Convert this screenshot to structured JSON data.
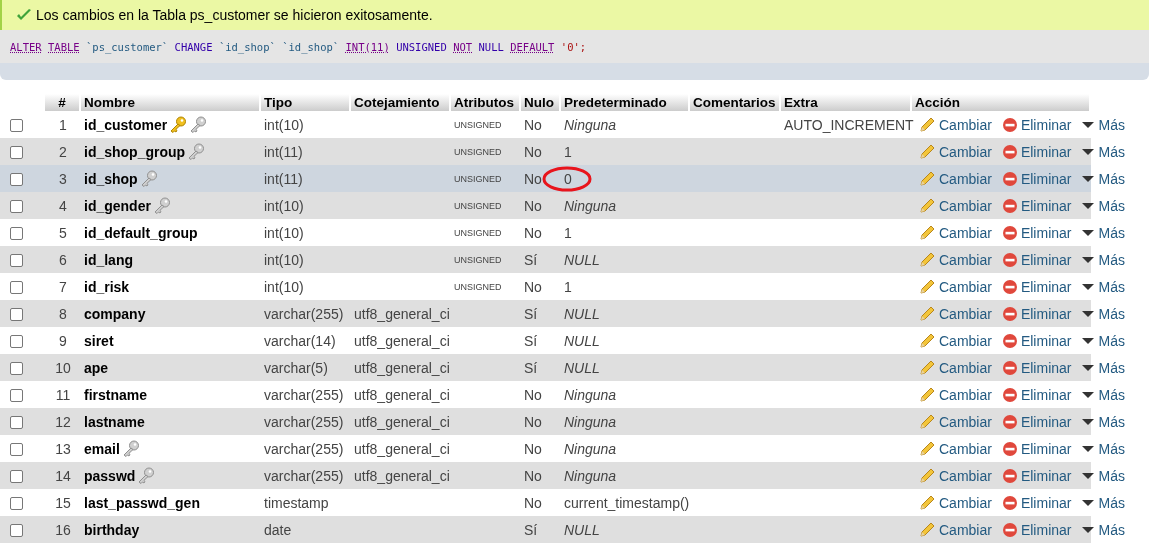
{
  "message": {
    "kind": "success",
    "text": "Los cambios en la Tabla ps_customer se hicieron exitosamente."
  },
  "sql": [
    {
      "kind": "keyword",
      "text": "ALTER"
    },
    {
      "kind": "keyword",
      "text": "TABLE"
    },
    {
      "kind": "ident",
      "text": "`ps_customer`"
    },
    {
      "kind": "plain",
      "text": "CHANGE"
    },
    {
      "kind": "ident",
      "text": "`id_shop`"
    },
    {
      "kind": "ident",
      "text": "`id_shop`"
    },
    {
      "kind": "func",
      "text": "INT(11)"
    },
    {
      "kind": "plain",
      "text": "UNSIGNED"
    },
    {
      "kind": "keyword",
      "text": "NOT"
    },
    {
      "kind": "plain",
      "text": "NULL"
    },
    {
      "kind": "keyword",
      "text": "DEFAULT"
    },
    {
      "kind": "string",
      "text": "'0';"
    }
  ],
  "table": {
    "columns": [
      "#",
      "Nombre",
      "Tipo",
      "Cotejamiento",
      "Atributos",
      "Nulo",
      "Predeterminado",
      "Comentarios",
      "Extra",
      "Acción"
    ],
    "rows": [
      {
        "num": "1",
        "name": "id_customer",
        "primary_key": true,
        "indexed": true,
        "type": "int(10)",
        "collation": "",
        "attributes": "UNSIGNED",
        "null": "No",
        "default": "Ninguna",
        "default_italic": true,
        "extra": "AUTO_INCREMENT",
        "checked": false,
        "highlighted": false,
        "circled": false,
        "actions": [
          "Cambiar",
          "Eliminar",
          "Más"
        ]
      },
      {
        "num": "2",
        "name": "id_shop_group",
        "primary_key": false,
        "indexed": true,
        "type": "int(11)",
        "collation": "",
        "attributes": "UNSIGNED",
        "null": "No",
        "default": "1",
        "default_italic": false,
        "extra": "",
        "checked": false,
        "highlighted": false,
        "circled": false,
        "actions": [
          "Cambiar",
          "Eliminar",
          "Más"
        ]
      },
      {
        "num": "3",
        "name": "id_shop",
        "primary_key": false,
        "indexed": true,
        "type": "int(11)",
        "collation": "",
        "attributes": "UNSIGNED",
        "null": "No",
        "default": "0",
        "default_italic": false,
        "extra": "",
        "checked": false,
        "highlighted": true,
        "circled": true,
        "actions": [
          "Cambiar",
          "Eliminar",
          "Más"
        ]
      },
      {
        "num": "4",
        "name": "id_gender",
        "primary_key": false,
        "indexed": true,
        "type": "int(10)",
        "collation": "",
        "attributes": "UNSIGNED",
        "null": "No",
        "default": "Ninguna",
        "default_italic": true,
        "extra": "",
        "checked": false,
        "highlighted": false,
        "circled": false,
        "actions": [
          "Cambiar",
          "Eliminar",
          "Más"
        ]
      },
      {
        "num": "5",
        "name": "id_default_group",
        "primary_key": false,
        "indexed": false,
        "type": "int(10)",
        "collation": "",
        "attributes": "UNSIGNED",
        "null": "No",
        "default": "1",
        "default_italic": false,
        "extra": "",
        "checked": false,
        "highlighted": false,
        "circled": false,
        "actions": [
          "Cambiar",
          "Eliminar",
          "Más"
        ]
      },
      {
        "num": "6",
        "name": "id_lang",
        "primary_key": false,
        "indexed": false,
        "type": "int(10)",
        "collation": "",
        "attributes": "UNSIGNED",
        "null": "Sí",
        "default": "NULL",
        "default_italic": true,
        "extra": "",
        "checked": false,
        "highlighted": false,
        "circled": false,
        "actions": [
          "Cambiar",
          "Eliminar",
          "Más"
        ]
      },
      {
        "num": "7",
        "name": "id_risk",
        "primary_key": false,
        "indexed": false,
        "type": "int(10)",
        "collation": "",
        "attributes": "UNSIGNED",
        "null": "No",
        "default": "1",
        "default_italic": false,
        "extra": "",
        "checked": false,
        "highlighted": false,
        "circled": false,
        "actions": [
          "Cambiar",
          "Eliminar",
          "Más"
        ]
      },
      {
        "num": "8",
        "name": "company",
        "primary_key": false,
        "indexed": false,
        "type": "varchar(255)",
        "collation": "utf8_general_ci",
        "attributes": "",
        "null": "Sí",
        "default": "NULL",
        "default_italic": true,
        "extra": "",
        "checked": false,
        "highlighted": false,
        "circled": false,
        "actions": [
          "Cambiar",
          "Eliminar",
          "Más"
        ]
      },
      {
        "num": "9",
        "name": "siret",
        "primary_key": false,
        "indexed": false,
        "type": "varchar(14)",
        "collation": "utf8_general_ci",
        "attributes": "",
        "null": "Sí",
        "default": "NULL",
        "default_italic": true,
        "extra": "",
        "checked": false,
        "highlighted": false,
        "circled": false,
        "actions": [
          "Cambiar",
          "Eliminar",
          "Más"
        ]
      },
      {
        "num": "10",
        "name": "ape",
        "primary_key": false,
        "indexed": false,
        "type": "varchar(5)",
        "collation": "utf8_general_ci",
        "attributes": "",
        "null": "Sí",
        "default": "NULL",
        "default_italic": true,
        "extra": "",
        "checked": false,
        "highlighted": false,
        "circled": false,
        "actions": [
          "Cambiar",
          "Eliminar",
          "Más"
        ]
      },
      {
        "num": "11",
        "name": "firstname",
        "primary_key": false,
        "indexed": false,
        "type": "varchar(255)",
        "collation": "utf8_general_ci",
        "attributes": "",
        "null": "No",
        "default": "Ninguna",
        "default_italic": true,
        "extra": "",
        "checked": false,
        "highlighted": false,
        "circled": false,
        "actions": [
          "Cambiar",
          "Eliminar",
          "Más"
        ]
      },
      {
        "num": "12",
        "name": "lastname",
        "primary_key": false,
        "indexed": false,
        "type": "varchar(255)",
        "collation": "utf8_general_ci",
        "attributes": "",
        "null": "No",
        "default": "Ninguna",
        "default_italic": true,
        "extra": "",
        "checked": false,
        "highlighted": false,
        "circled": false,
        "actions": [
          "Cambiar",
          "Eliminar",
          "Más"
        ]
      },
      {
        "num": "13",
        "name": "email",
        "primary_key": false,
        "indexed": true,
        "type": "varchar(255)",
        "collation": "utf8_general_ci",
        "attributes": "",
        "null": "No",
        "default": "Ninguna",
        "default_italic": true,
        "extra": "",
        "checked": false,
        "highlighted": false,
        "circled": false,
        "actions": [
          "Cambiar",
          "Eliminar",
          "Más"
        ]
      },
      {
        "num": "14",
        "name": "passwd",
        "primary_key": false,
        "indexed": true,
        "type": "varchar(255)",
        "collation": "utf8_general_ci",
        "attributes": "",
        "null": "No",
        "default": "Ninguna",
        "default_italic": true,
        "extra": "",
        "checked": false,
        "highlighted": false,
        "circled": false,
        "actions": [
          "Cambiar",
          "Eliminar",
          "Más"
        ]
      },
      {
        "num": "15",
        "name": "last_passwd_gen",
        "primary_key": false,
        "indexed": false,
        "type": "timestamp",
        "collation": "",
        "attributes": "",
        "null": "No",
        "default": "current_timestamp()",
        "default_italic": false,
        "extra": "",
        "checked": false,
        "highlighted": false,
        "circled": false,
        "actions": [
          "Cambiar",
          "Eliminar",
          "Más"
        ]
      },
      {
        "num": "16",
        "name": "birthday",
        "primary_key": false,
        "indexed": false,
        "type": "date",
        "collation": "",
        "attributes": "",
        "null": "Sí",
        "default": "NULL",
        "default_italic": true,
        "extra": "",
        "checked": false,
        "highlighted": false,
        "circled": false,
        "actions": [
          "Cambiar",
          "Eliminar",
          "Más"
        ]
      }
    ]
  }
}
